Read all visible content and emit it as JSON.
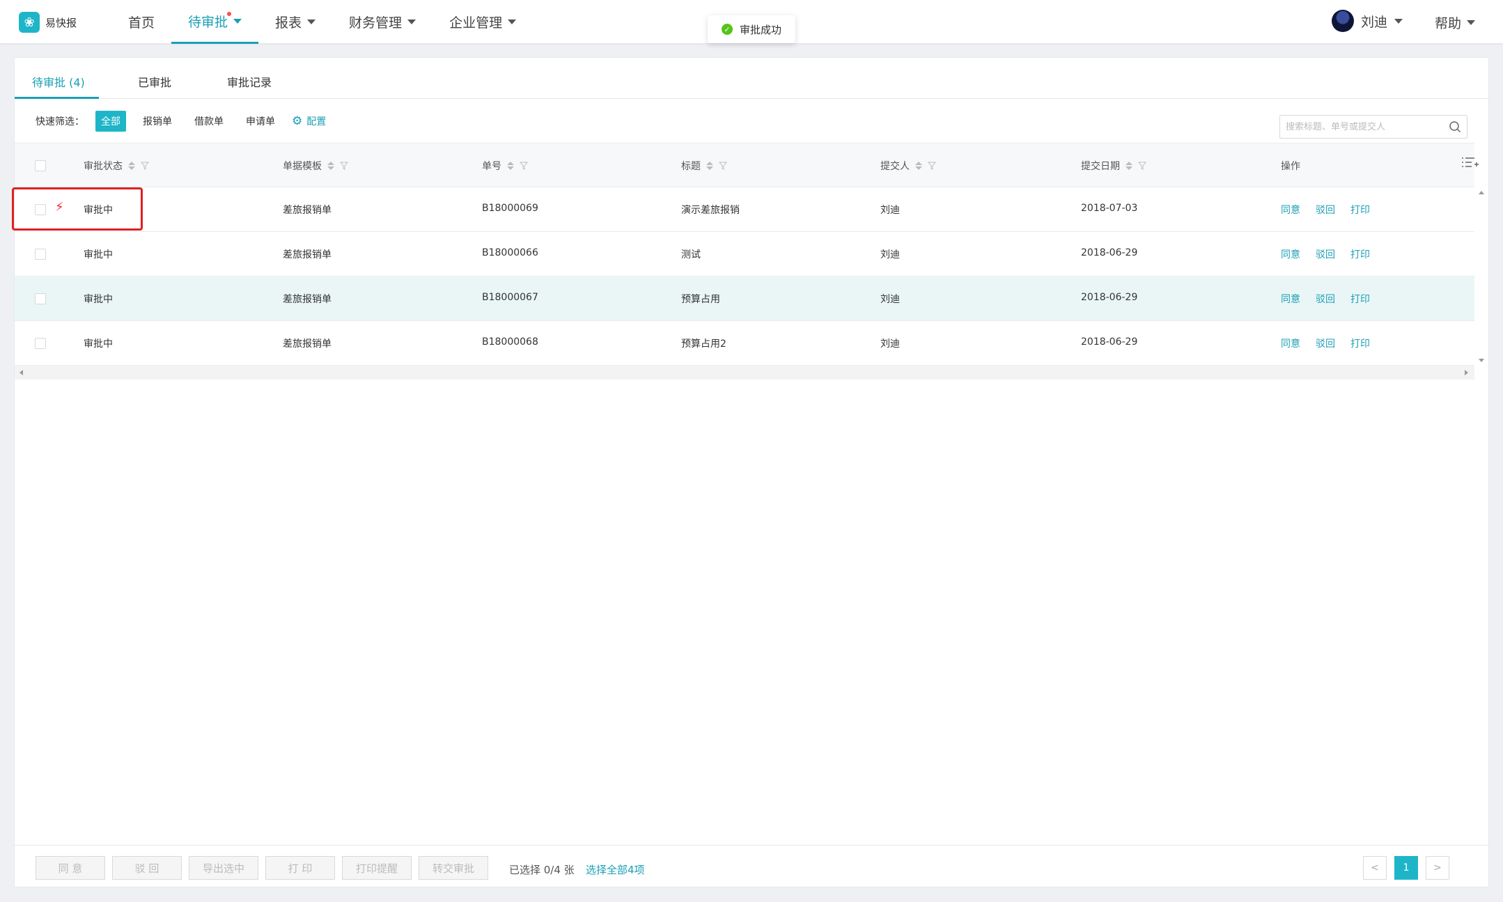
{
  "app": {
    "name": "易快报"
  },
  "nav": {
    "home": "首页",
    "pending": "待审批",
    "reports": "报表",
    "finance": "财务管理",
    "enterprise": "企业管理"
  },
  "toast": {
    "text": "审批成功"
  },
  "user": {
    "name": "刘迪"
  },
  "help": {
    "label": "帮助"
  },
  "tabs": [
    {
      "label": "待审批 (4)"
    },
    {
      "label": "已审批"
    },
    {
      "label": "审批记录"
    }
  ],
  "filters": {
    "label": "快速筛选：",
    "chips": [
      "全部",
      "报销单",
      "借款单",
      "申请单"
    ],
    "config": "配置"
  },
  "search": {
    "placeholder": "搜索标题、单号或提交人"
  },
  "table": {
    "headers": [
      "审批状态",
      "单据模板",
      "单号",
      "标题",
      "提交人",
      "提交日期",
      "操作"
    ],
    "rows": [
      {
        "status": "审批中",
        "template": "差旅报销单",
        "number": "B18000069",
        "title": "演示差旅报销",
        "submitter": "刘迪",
        "date": "2018-07-03",
        "urgent": true
      },
      {
        "status": "审批中",
        "template": "差旅报销单",
        "number": "B18000066",
        "title": "测试",
        "submitter": "刘迪",
        "date": "2018-06-29",
        "urgent": false
      },
      {
        "status": "审批中",
        "template": "差旅报销单",
        "number": "B18000067",
        "title": "预算占用",
        "submitter": "刘迪",
        "date": "2018-06-29",
        "urgent": false
      },
      {
        "status": "审批中",
        "template": "差旅报销单",
        "number": "B18000068",
        "title": "预算占用2",
        "submitter": "刘迪",
        "date": "2018-06-29",
        "urgent": false
      }
    ],
    "actions": {
      "approve": "同意",
      "reject": "驳回",
      "print": "打印"
    }
  },
  "footer": {
    "buttons": [
      "同 意",
      "驳 回",
      "导出选中",
      "打 印",
      "打印提醒",
      "转交审批"
    ],
    "selected_info": "已选择 0/4 张",
    "select_all": "选择全部4项",
    "prev": "<",
    "page": "1",
    "next": ">"
  },
  "colors": {
    "accent": "#1fb5c8",
    "link": "#1a9fb5",
    "urgent": "#f5222d",
    "success": "#52c41a"
  }
}
